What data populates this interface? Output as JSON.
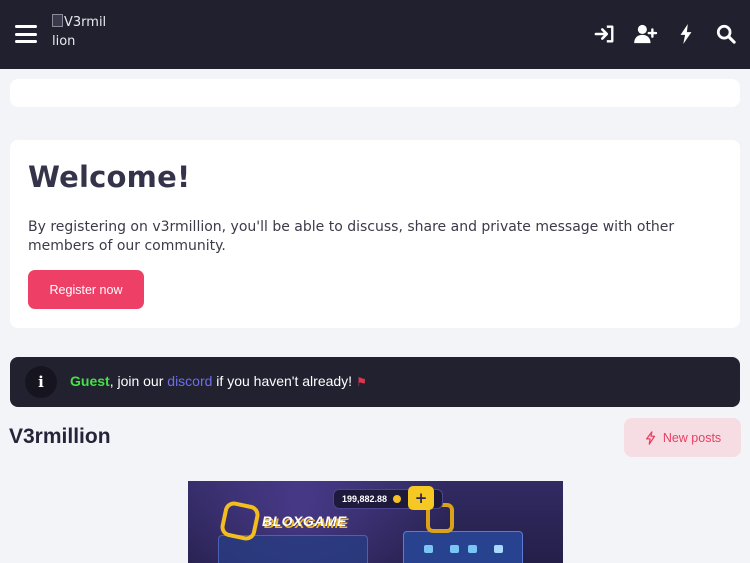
{
  "header": {
    "logo_alt_line1": "V3rmil",
    "logo_alt_line2": "lion",
    "icons": [
      "menu-icon",
      "login-icon",
      "register-icon",
      "whats-new-icon",
      "search-icon"
    ]
  },
  "welcome": {
    "title": "Welcome!",
    "text": "By registering on v3rmillion, you'll be able to discuss, share and private message with other members of our community.",
    "register_label": "Register now"
  },
  "notice": {
    "icon_glyph": "i",
    "guest": "Guest",
    "text_before_link": ", join our ",
    "discord_link": "discord",
    "text_after_link": " if you haven't already!",
    "flag_glyph": "⚑"
  },
  "forum": {
    "title": "V3rmillion",
    "new_posts_label": "New posts"
  },
  "banner": {
    "balance": "199,882.88",
    "plus": "+",
    "brand": "BLOXGAME"
  },
  "colors": {
    "header_bg": "#21202e",
    "accent": "#ee4066",
    "guest": "#45e04a",
    "link": "#6d70e8",
    "new_posts_bg": "#f6dde4"
  }
}
